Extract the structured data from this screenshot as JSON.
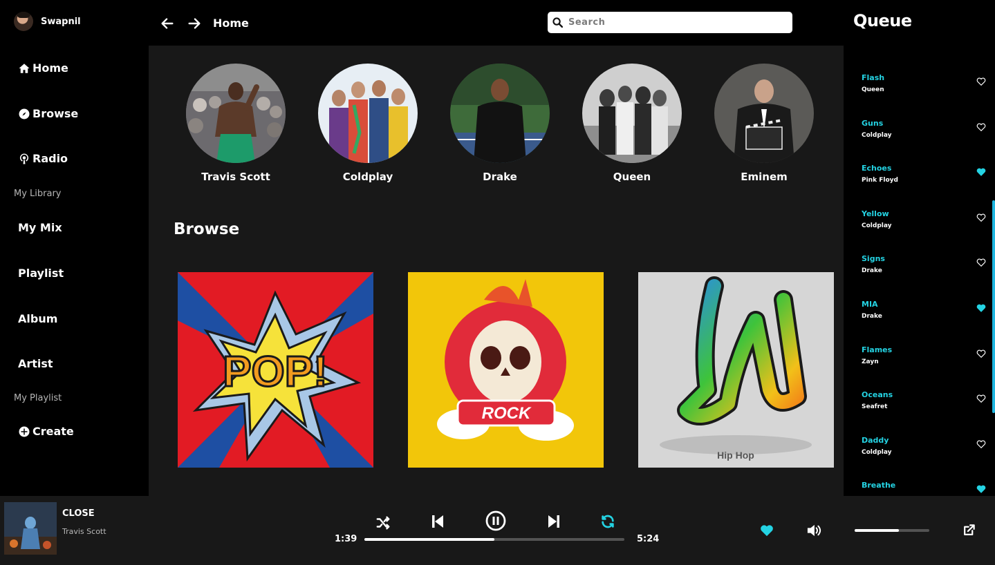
{
  "user": {
    "name": "Swapnil"
  },
  "nav": {
    "home": "Home",
    "browse": "Browse",
    "radio": "Radio",
    "library_heading": "My Library",
    "library": [
      "My Mix",
      "Playlist",
      "Album",
      "Artist"
    ],
    "playlist_heading": "My Playlist",
    "create": "Create"
  },
  "topbar": {
    "breadcrumb": "Home",
    "search_placeholder": "Search"
  },
  "artists": [
    "Travis Scott",
    "Coldplay",
    "Drake",
    "Queen",
    "Eminem"
  ],
  "browse": {
    "title": "Browse",
    "cards": [
      {
        "label": "POP!"
      },
      {
        "label": "ROCK"
      },
      {
        "label": "Hip Hop"
      }
    ]
  },
  "queue": {
    "title": "Queue",
    "items": [
      {
        "song": "Flash",
        "artist": "Queen",
        "liked": false
      },
      {
        "song": "Guns",
        "artist": "Coldplay",
        "liked": false
      },
      {
        "song": "Echoes",
        "artist": "Pink Floyd",
        "liked": true
      },
      {
        "song": "Yellow",
        "artist": "Coldplay",
        "liked": false
      },
      {
        "song": "Signs",
        "artist": "Drake",
        "liked": false
      },
      {
        "song": "MIA",
        "artist": "Drake",
        "liked": true
      },
      {
        "song": "Flames",
        "artist": "Zayn",
        "liked": false
      },
      {
        "song": "Oceans",
        "artist": "Seafret",
        "liked": false
      },
      {
        "song": "Daddy",
        "artist": "Coldplay",
        "liked": false
      },
      {
        "song": "Breathe",
        "artist": "",
        "liked": true
      }
    ]
  },
  "player": {
    "title": "CLOSE",
    "artist": "Travis Scott",
    "elapsed": "1:39",
    "duration": "5:24",
    "progress": 0.5,
    "volume": 0.59,
    "liked": true
  },
  "colors": {
    "accent": "#24d3e3",
    "background": "#181818",
    "sidebar": "#000000"
  }
}
